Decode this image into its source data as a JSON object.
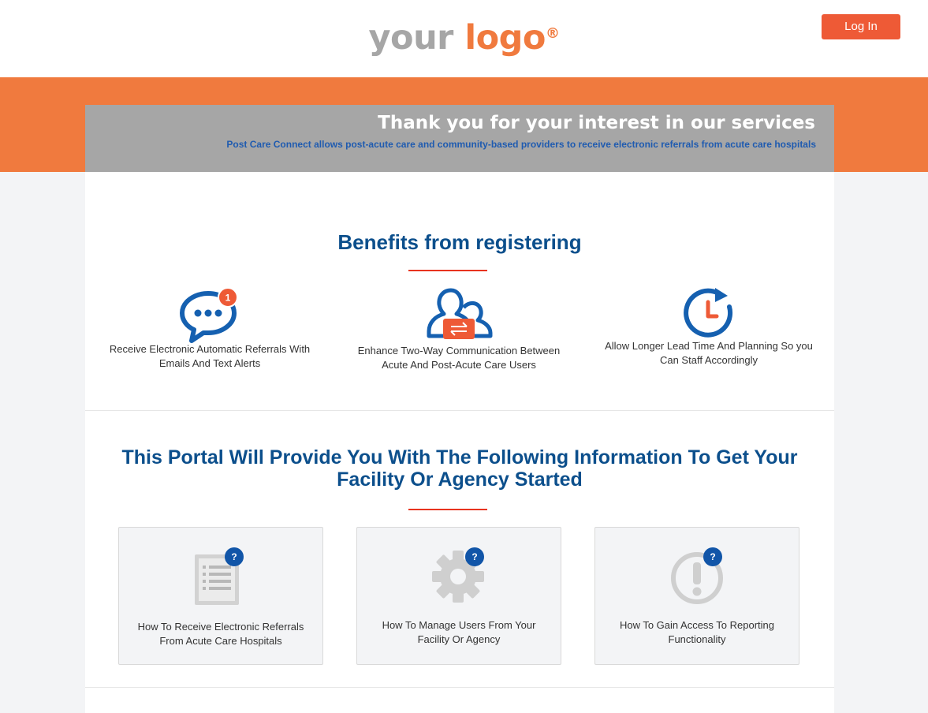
{
  "header": {
    "logo_word_1": "your",
    "logo_word_2": "logo",
    "logo_mark": "®",
    "login_label": "Log In"
  },
  "banner": {
    "title": "Thank you for your interest in our services",
    "subtitle": "Post Care Connect allows post-acute care and community-based providers to receive electronic referrals from acute care hospitals"
  },
  "benefits": {
    "heading": "Benefits from registering",
    "items": [
      {
        "icon": "chat-bubble-icon",
        "badge": "1",
        "line1": "Receive Electronic Automatic Referrals With",
        "line2": "Emails And Text Alerts"
      },
      {
        "icon": "users-exchange-icon",
        "line1": "Enhance Two-Way Communication Between",
        "line2": "Acute And Post-Acute Care Users"
      },
      {
        "icon": "clock-icon",
        "line1": "Allow Longer Lead Time And Planning So you",
        "line2": "Can Staff Accordingly"
      }
    ]
  },
  "portal": {
    "heading_line1": "This Portal Will Provide You With The Following Information To Get Your",
    "heading_line2": "Facility Or Agency Started",
    "cards": [
      {
        "icon": "document-list-icon",
        "badge": "?",
        "line1": "How To Receive Electronic Referrals",
        "line2": "From Acute Care Hospitals"
      },
      {
        "icon": "gear-icon",
        "badge": "?",
        "line1": "How To Manage Users From Your",
        "line2": "Facility Or Agency"
      },
      {
        "icon": "exclamation-icon",
        "badge": "?",
        "line1": "How To Gain Access To Reporting",
        "line2": "Functionality"
      }
    ]
  },
  "colors": {
    "brand_orange": "#f07a3e",
    "login_button": "#ee5a36",
    "heading_blue": "#0c4f8c",
    "icon_blue": "#1560b0",
    "banner_gray": "#a6a6a6",
    "accent_red": "#e8331f"
  }
}
